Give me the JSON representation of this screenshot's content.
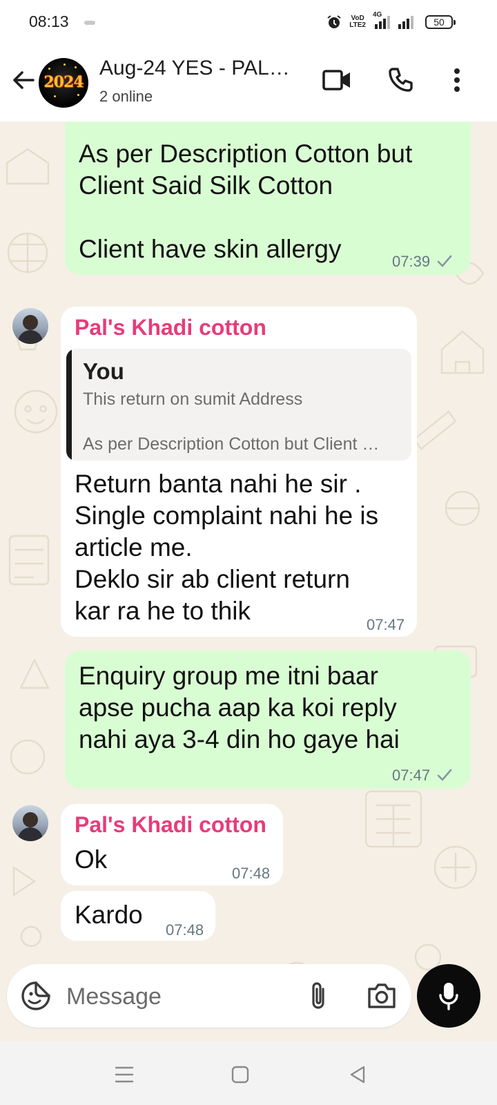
{
  "status_bar": {
    "time": "08:13",
    "network_label_top": "VoD",
    "network_label_bottom": "LTE2",
    "network_type": "4G",
    "battery": "50"
  },
  "header": {
    "title": "Aug-24 YES - PAL…",
    "subtitle": "2 online",
    "avatar_text": "2024"
  },
  "messages": [
    {
      "direction": "outgoing",
      "text": "As per Description Cotton but\nClient Said Silk Cotton\n\nClient have skin allergy",
      "time": "07:39",
      "status": "sent"
    },
    {
      "direction": "incoming",
      "sender": "Pal's Khadi cotton",
      "quote": {
        "author": "You",
        "line1": "This return on sumit Address",
        "line2": "As per Description Cotton but Client …"
      },
      "text": "Return banta nahi he sir .\nSingle complaint nahi he is\narticle me.\nDeklo sir ab client return\nkar ra he to thik",
      "time": "07:47"
    },
    {
      "direction": "outgoing",
      "text": "Enquiry group me itni baar\napse pucha aap ka koi reply\nnahi aya 3-4 din ho gaye hai",
      "time": "07:47",
      "status": "sent"
    },
    {
      "direction": "incoming",
      "sender": "Pal's Khadi cotton",
      "text": "Ok",
      "time": "07:48"
    },
    {
      "direction": "incoming",
      "text": "Kardo",
      "time": "07:48"
    }
  ],
  "composer": {
    "placeholder": "Message"
  },
  "colors": {
    "outgoing_bubble": "#d9fdd3",
    "incoming_bubble": "#ffffff",
    "sender_name": "#e73c79",
    "chat_background": "#f5efe6",
    "mic_button": "#0b0b0b"
  },
  "icons": {
    "back": "arrow-left-icon",
    "video": "video-camera-icon",
    "call": "phone-icon",
    "menu": "more-vertical-icon",
    "sticker": "sticker-icon",
    "attach": "paperclip-icon",
    "camera": "camera-icon",
    "mic": "microphone-icon"
  }
}
